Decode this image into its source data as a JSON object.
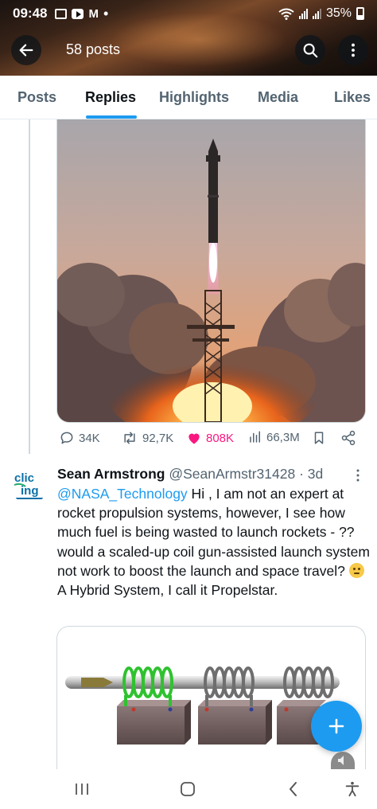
{
  "status_bar": {
    "time": "09:48",
    "notification_m": "M",
    "notification_dot": "•",
    "battery": "35%"
  },
  "header": {
    "title": "58 posts",
    "icons": [
      "back-arrow-icon",
      "search-icon",
      "more-vertical-icon"
    ]
  },
  "tabs": [
    {
      "label": "Posts"
    },
    {
      "label": "Replies",
      "active": true
    },
    {
      "label": "Highlights"
    },
    {
      "label": "Media"
    },
    {
      "label": "Likes"
    }
  ],
  "tweet_actions": {
    "replies": "34K",
    "reposts": "92,7K",
    "likes": "808K",
    "views": "66,3M"
  },
  "reply": {
    "avatar_text": [
      "clic",
      "ing"
    ],
    "name": "Sean Armstrong",
    "handle": "@SeanArmstr31428",
    "separator": "·",
    "time": "3d",
    "mention": "@NASA_Technology",
    "text": " Hi , I am not an expert at rocket propulsion systems, however, I see how much fuel is being wasted to launch rockets - ?? would a scaled-up coil gun-assisted launch system not work to boost the launch and space travel? ",
    "text_after_emoji": " A Hybrid System, I call it Propelstar."
  },
  "colors": {
    "accent": "#1d9bf0",
    "like": "#f91880",
    "secondary_text": "#536471"
  }
}
